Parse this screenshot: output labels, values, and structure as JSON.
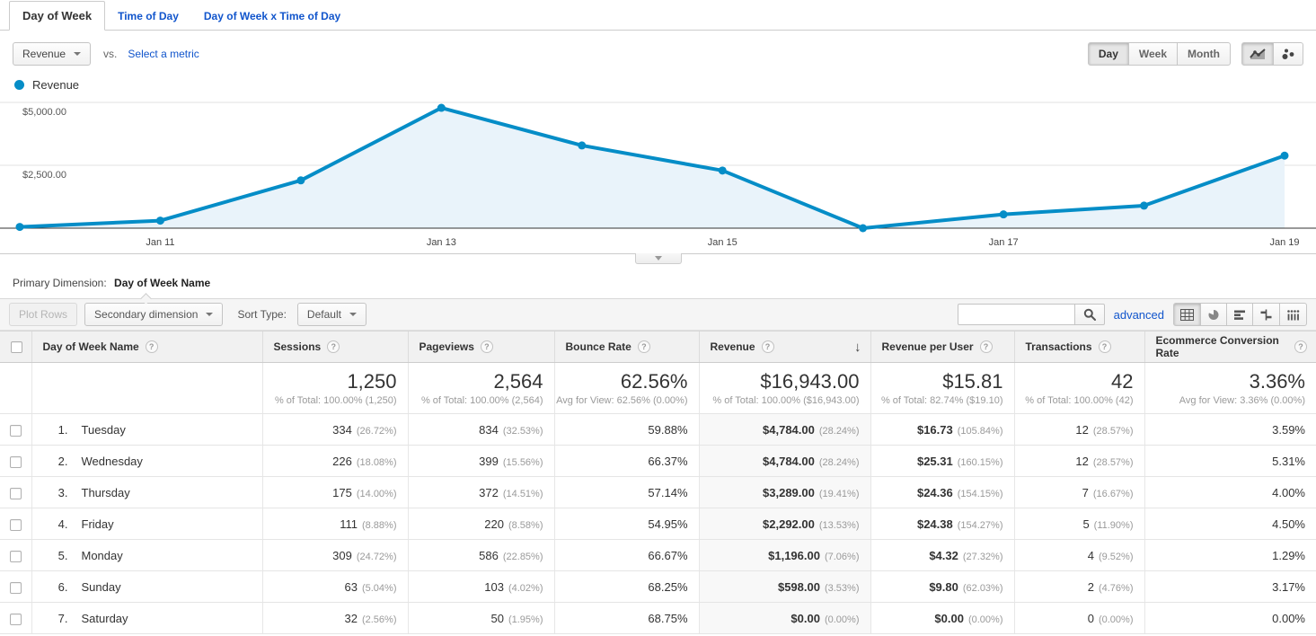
{
  "app": {
    "accent": "#058dc7",
    "link_color": "#1155cc"
  },
  "icons": {
    "help": "?",
    "sort_desc": "↓"
  },
  "tabs": [
    {
      "label": "Day of Week",
      "active": true
    },
    {
      "label": "Time of Day",
      "active": false
    },
    {
      "label": "Day of Week x Time of Day",
      "active": false
    }
  ],
  "controls": {
    "metric_selector": "Revenue",
    "vs_label": "vs.",
    "select_metric_label": "Select a metric",
    "granularity": [
      {
        "label": "Day",
        "active": true
      },
      {
        "label": "Week",
        "active": false
      },
      {
        "label": "Month",
        "active": false
      }
    ]
  },
  "legend": {
    "series_label": "Revenue"
  },
  "chart_data": {
    "type": "area",
    "title": "Revenue by day",
    "x": [
      "Jan 10",
      "Jan 11",
      "Jan 12",
      "Jan 13",
      "Jan 14",
      "Jan 15",
      "Jan 16",
      "Jan 17",
      "Jan 18",
      "Jan 19"
    ],
    "series": [
      {
        "name": "Revenue",
        "color": "#058dc7",
        "values": [
          50,
          300,
          1900,
          4784,
          3289,
          2292,
          0,
          548,
          896,
          2884
        ]
      }
    ],
    "x_tick_labels": [
      "Jan 11",
      "Jan 13",
      "Jan 15",
      "Jan 17",
      "Jan 19"
    ],
    "x_tick_indices": [
      1,
      3,
      5,
      7,
      9
    ],
    "y_ticks": [
      2500,
      5000
    ],
    "y_tick_labels": [
      "$2,500.00",
      "$5,000.00"
    ],
    "ylim": [
      0,
      5357
    ],
    "grid": true,
    "legend_position": "top-left"
  },
  "primary_dimension": {
    "label": "Primary Dimension:",
    "value": "Day of Week Name"
  },
  "toolbar": {
    "plot_rows_label": "Plot Rows",
    "secondary_dimension_label": "Secondary dimension",
    "sort_type_label": "Sort Type:",
    "sort_type_value": "Default",
    "search_value": "",
    "advanced_label": "advanced"
  },
  "table": {
    "columns": [
      "Day of Week Name",
      "Sessions",
      "Pageviews",
      "Bounce Rate",
      "Revenue",
      "Revenue per User",
      "Transactions",
      "Ecommerce Conversion Rate"
    ],
    "sorted_column": "Revenue",
    "totals": [
      {
        "main": "1,250",
        "sub": "% of Total: 100.00% (1,250)"
      },
      {
        "main": "2,564",
        "sub": "% of Total: 100.00% (2,564)"
      },
      {
        "main": "62.56%",
        "sub": "Avg for View: 62.56% (0.00%)"
      },
      {
        "main": "$16,943.00",
        "sub": "% of Total: 100.00% ($16,943.00)"
      },
      {
        "main": "$15.81",
        "sub": "% of Total: 82.74% ($19.10)"
      },
      {
        "main": "42",
        "sub": "% of Total: 100.00% (42)"
      },
      {
        "main": "3.36%",
        "sub": "Avg for View: 3.36% (0.00%)"
      }
    ],
    "rows": [
      {
        "index": "1.",
        "name": "Tuesday",
        "cells": [
          {
            "main": "334",
            "sub": "(26.72%)"
          },
          {
            "main": "834",
            "sub": "(32.53%)"
          },
          {
            "main": "59.88%"
          },
          {
            "main": "$4,784.00",
            "sub": "(28.24%)"
          },
          {
            "main": "$16.73",
            "sub": "(105.84%)"
          },
          {
            "main": "12",
            "sub": "(28.57%)"
          },
          {
            "main": "3.59%"
          }
        ]
      },
      {
        "index": "2.",
        "name": "Wednesday",
        "cells": [
          {
            "main": "226",
            "sub": "(18.08%)"
          },
          {
            "main": "399",
            "sub": "(15.56%)"
          },
          {
            "main": "66.37%"
          },
          {
            "main": "$4,784.00",
            "sub": "(28.24%)"
          },
          {
            "main": "$25.31",
            "sub": "(160.15%)"
          },
          {
            "main": "12",
            "sub": "(28.57%)"
          },
          {
            "main": "5.31%"
          }
        ]
      },
      {
        "index": "3.",
        "name": "Thursday",
        "cells": [
          {
            "main": "175",
            "sub": "(14.00%)"
          },
          {
            "main": "372",
            "sub": "(14.51%)"
          },
          {
            "main": "57.14%"
          },
          {
            "main": "$3,289.00",
            "sub": "(19.41%)"
          },
          {
            "main": "$24.36",
            "sub": "(154.15%)"
          },
          {
            "main": "7",
            "sub": "(16.67%)"
          },
          {
            "main": "4.00%"
          }
        ]
      },
      {
        "index": "4.",
        "name": "Friday",
        "cells": [
          {
            "main": "111",
            "sub": "(8.88%)"
          },
          {
            "main": "220",
            "sub": "(8.58%)"
          },
          {
            "main": "54.95%"
          },
          {
            "main": "$2,292.00",
            "sub": "(13.53%)"
          },
          {
            "main": "$24.38",
            "sub": "(154.27%)"
          },
          {
            "main": "5",
            "sub": "(11.90%)"
          },
          {
            "main": "4.50%"
          }
        ]
      },
      {
        "index": "5.",
        "name": "Monday",
        "cells": [
          {
            "main": "309",
            "sub": "(24.72%)"
          },
          {
            "main": "586",
            "sub": "(22.85%)"
          },
          {
            "main": "66.67%"
          },
          {
            "main": "$1,196.00",
            "sub": "(7.06%)"
          },
          {
            "main": "$4.32",
            "sub": "(27.32%)"
          },
          {
            "main": "4",
            "sub": "(9.52%)"
          },
          {
            "main": "1.29%"
          }
        ]
      },
      {
        "index": "6.",
        "name": "Sunday",
        "cells": [
          {
            "main": "63",
            "sub": "(5.04%)"
          },
          {
            "main": "103",
            "sub": "(4.02%)"
          },
          {
            "main": "68.25%"
          },
          {
            "main": "$598.00",
            "sub": "(3.53%)"
          },
          {
            "main": "$9.80",
            "sub": "(62.03%)"
          },
          {
            "main": "2",
            "sub": "(4.76%)"
          },
          {
            "main": "3.17%"
          }
        ]
      },
      {
        "index": "7.",
        "name": "Saturday",
        "cells": [
          {
            "main": "32",
            "sub": "(2.56%)"
          },
          {
            "main": "50",
            "sub": "(1.95%)"
          },
          {
            "main": "68.75%"
          },
          {
            "main": "$0.00",
            "sub": "(0.00%)"
          },
          {
            "main": "$0.00",
            "sub": "(0.00%)"
          },
          {
            "main": "0",
            "sub": "(0.00%)"
          },
          {
            "main": "0.00%"
          }
        ]
      }
    ]
  }
}
